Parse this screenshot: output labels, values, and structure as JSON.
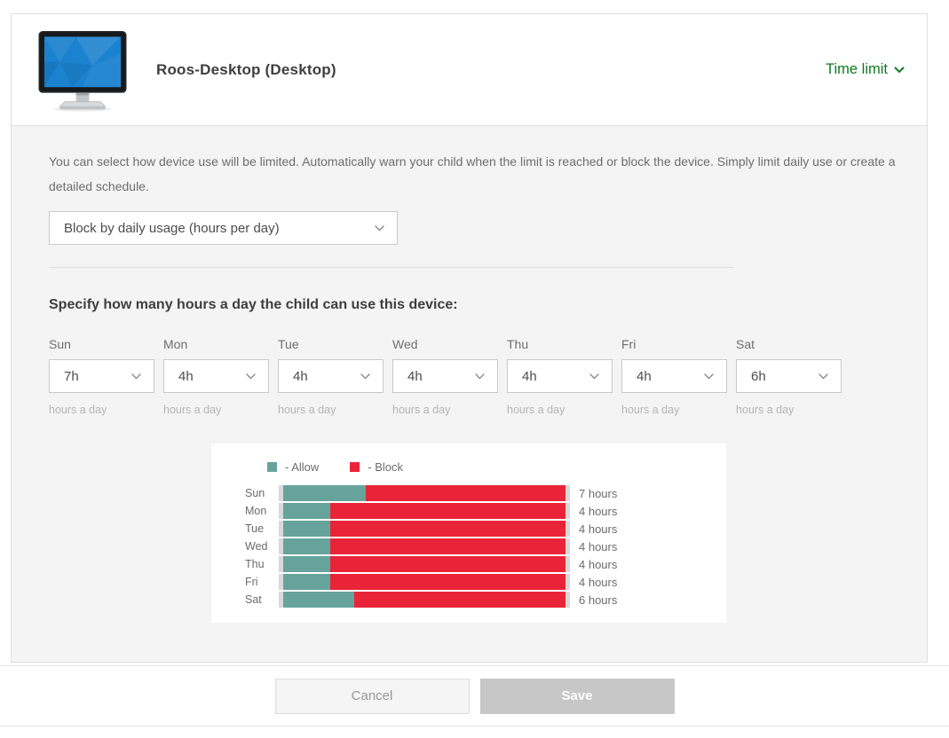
{
  "header": {
    "device_name": "Roos-Desktop (Desktop)",
    "time_limit_label": "Time limit"
  },
  "body": {
    "description": "You can select how device use will be limited. Automatically warn your child when the limit is reached or block the device. Simply limit daily use or create a detailed schedule.",
    "limit_mode": {
      "selected": "Block by daily usage (hours per day)"
    },
    "schedule_heading": "Specify how many hours a day the child can use this device:",
    "unit_caption": "hours a day",
    "days": [
      {
        "label": "Sun",
        "selected": "7h",
        "hours": 7
      },
      {
        "label": "Mon",
        "selected": "4h",
        "hours": 4
      },
      {
        "label": "Tue",
        "selected": "4h",
        "hours": 4
      },
      {
        "label": "Wed",
        "selected": "4h",
        "hours": 4
      },
      {
        "label": "Thu",
        "selected": "4h",
        "hours": 4
      },
      {
        "label": "Fri",
        "selected": "4h",
        "hours": 4
      },
      {
        "label": "Sat",
        "selected": "6h",
        "hours": 6
      }
    ]
  },
  "chart_data": {
    "type": "bar",
    "orientation": "horizontal",
    "stacked": true,
    "x_max_hours": 24,
    "categories": [
      "Sun",
      "Mon",
      "Tue",
      "Wed",
      "Thu",
      "Fri",
      "Sat"
    ],
    "series": [
      {
        "name": "Allow",
        "color": "#66A49B",
        "values": [
          7,
          4,
          4,
          4,
          4,
          4,
          6
        ]
      },
      {
        "name": "Block",
        "color": "#EA2438",
        "values": [
          17,
          20,
          20,
          20,
          20,
          20,
          18
        ]
      }
    ],
    "legend": [
      {
        "label": "- Allow",
        "color": "#66A49B"
      },
      {
        "label": "- Block",
        "color": "#EA2438"
      }
    ],
    "value_labels": [
      "7 hours",
      "4 hours",
      "4 hours",
      "4 hours",
      "4 hours",
      "4 hours",
      "6 hours"
    ],
    "legend_position": "top"
  },
  "footer": {
    "cancel_label": "Cancel",
    "save_label": "Save"
  },
  "colors": {
    "accent_green": "#0D7A21",
    "allow": "#66A49B",
    "block": "#EA2438",
    "panel_bg": "#F4F4F4"
  }
}
